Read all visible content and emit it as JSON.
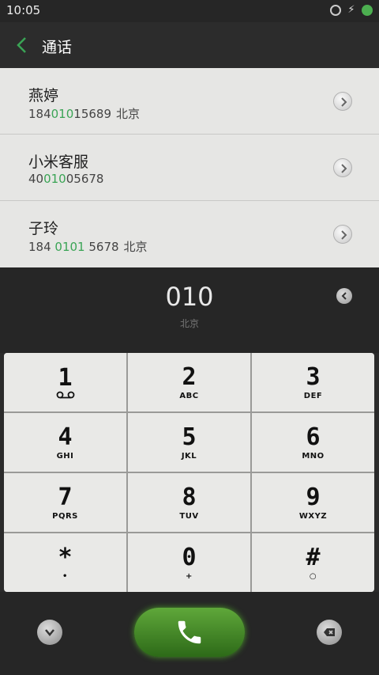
{
  "status": {
    "time": "10:05"
  },
  "header": {
    "title": "通话"
  },
  "contacts": [
    {
      "name": "燕婷",
      "num_pre": "184",
      "num_hl": "010",
      "num_post": "15689",
      "location": "北京"
    },
    {
      "name": "小米客服",
      "num_pre": "40",
      "num_hl": "010",
      "num_post": "05678",
      "location": ""
    },
    {
      "name": "子玲",
      "num_pre": "184 ",
      "num_hl": "0101",
      "num_post": " 5678",
      "location": "北京"
    }
  ],
  "dialer": {
    "digits": "010",
    "location": "北京"
  },
  "keypad": [
    {
      "digit": "1",
      "sub": "voicemail"
    },
    {
      "digit": "2",
      "sub": "ABC"
    },
    {
      "digit": "3",
      "sub": "DEF"
    },
    {
      "digit": "4",
      "sub": "GHI"
    },
    {
      "digit": "5",
      "sub": "JKL"
    },
    {
      "digit": "6",
      "sub": "MNO"
    },
    {
      "digit": "7",
      "sub": "PQRS"
    },
    {
      "digit": "8",
      "sub": "TUV"
    },
    {
      "digit": "9",
      "sub": "WXYZ"
    },
    {
      "digit": "*",
      "sub": "•"
    },
    {
      "digit": "0",
      "sub": "+"
    },
    {
      "digit": "#",
      "sub": "○"
    }
  ],
  "colors": {
    "accent": "#3aa455",
    "call": "#4a9a2a",
    "list_bg": "#e6e6e4",
    "keypad_bg": "#e9e9e7"
  }
}
